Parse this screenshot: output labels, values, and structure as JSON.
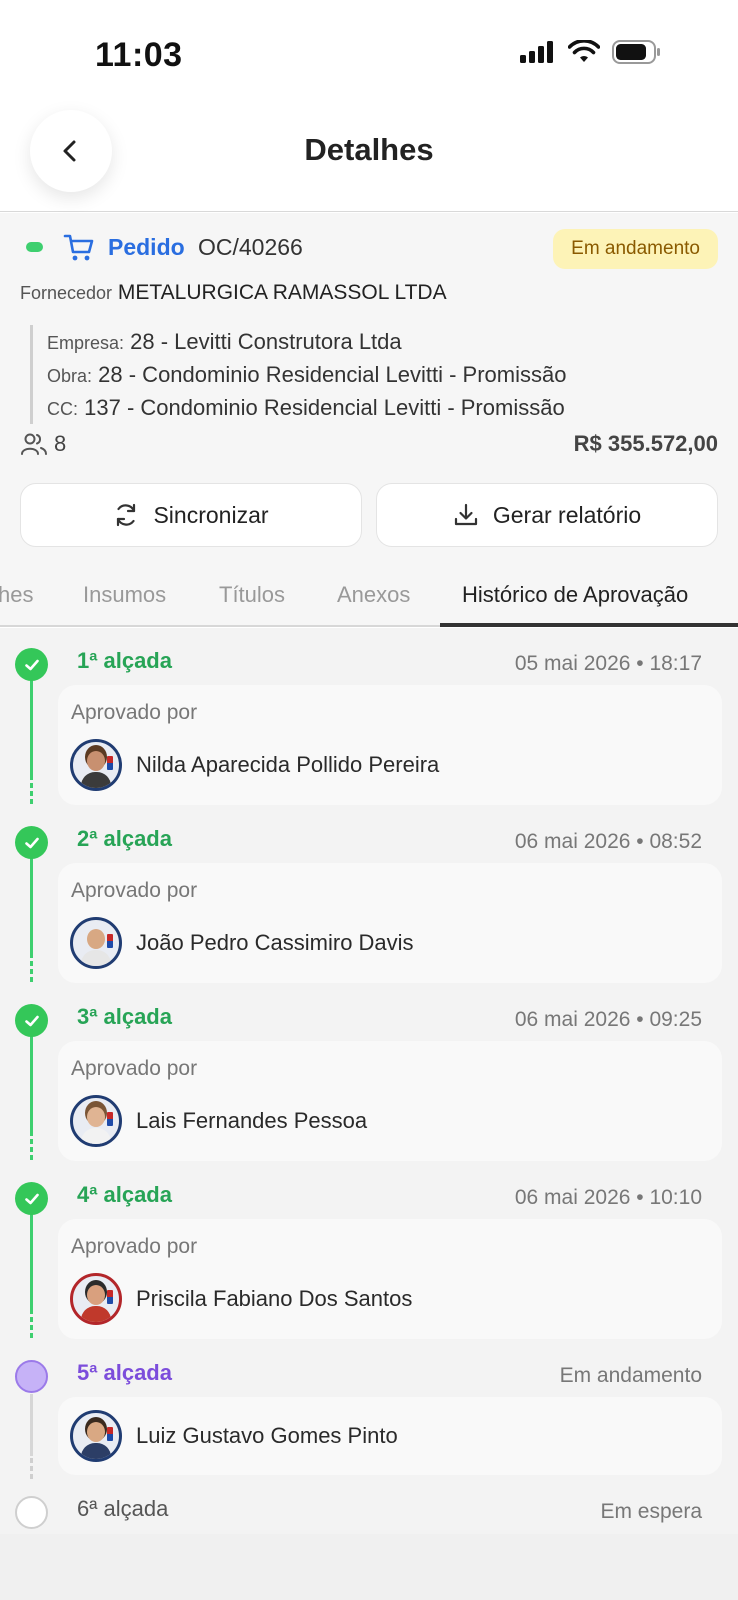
{
  "status_bar": {
    "time": "11:03"
  },
  "header": {
    "title": "Detalhes"
  },
  "order": {
    "type": "Pedido",
    "number": "OC/40266",
    "status": "Em andamento",
    "supplier_label": "Fornecedor",
    "supplier": "METALURGICA RAMASSOL LTDA",
    "empresa_label": "Empresa:",
    "empresa": "28 - Levitti Construtora Ltda",
    "obra_label": "Obra:",
    "obra": "28 - Condominio Residencial Levitti - Promissão",
    "cc_label": "CC:",
    "cc": "137 - Condominio Residencial Levitti - Promissão",
    "approvers_count": "8",
    "amount": "R$ 355.572,00",
    "sync_label": "Sincronizar",
    "report_label": "Gerar relatório"
  },
  "tabs": [
    {
      "label": "hes"
    },
    {
      "label": "Insumos"
    },
    {
      "label": "Títulos"
    },
    {
      "label": "Anexos"
    },
    {
      "label": "Histórico de Aprovação"
    }
  ],
  "history": {
    "approved_by_label": "Aprovado por",
    "levels": [
      {
        "title": "1ª alçada",
        "date": "05 mai 2026 • 18:17",
        "person": "Nilda Aparecida Pollido Pereira",
        "state": "approved"
      },
      {
        "title": "2ª alçada",
        "date": "06 mai 2026 • 08:52",
        "person": "João Pedro Cassimiro Davis",
        "state": "approved"
      },
      {
        "title": "3ª alçada",
        "date": "06 mai 2026 • 09:25",
        "person": "Lais Fernandes Pessoa",
        "state": "approved"
      },
      {
        "title": "4ª alçada",
        "date": "06 mai 2026 • 10:10",
        "person": "Priscila Fabiano Dos Santos",
        "state": "approved"
      },
      {
        "title": "5ª alçada",
        "date": "Em andamento",
        "person": "Luiz Gustavo Gomes Pinto",
        "state": "in-progress"
      },
      {
        "title": "6ª alçada",
        "date": "Em espera",
        "state": "waiting"
      }
    ]
  },
  "colors": {
    "accent_blue": "#2a6ee0",
    "approved_green": "#27a456",
    "progress_purple": "#7c4ddb",
    "status_badge_bg": "#fdf3b7"
  }
}
